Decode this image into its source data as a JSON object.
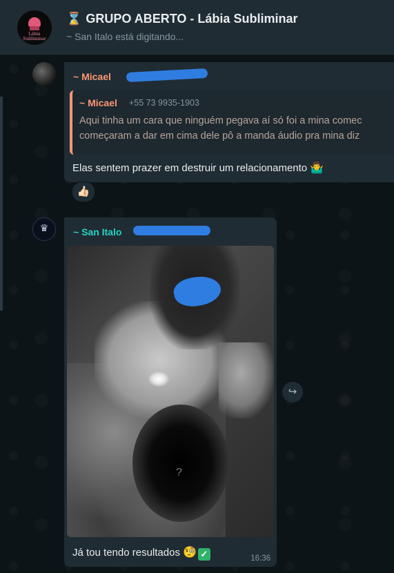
{
  "header": {
    "group_avatar_text": "Lábia Subliminar",
    "hourglass": "⌛",
    "title": "GRUPO ABERTO - Lábia Subliminar",
    "status": "~ San Italo está digitando..."
  },
  "messages": [
    {
      "sender": "~ Micael",
      "quote": {
        "name": "~ Micael",
        "phone": "+55 73 9935-1903",
        "lines": [
          "Aqui tinha um cara que ninguém pegava aí só foi a mina comec",
          "começaram a dar em cima dele pô a manda áudio pra mina diz"
        ]
      },
      "text": "Elas sentem prazer em destruir um relacionamento",
      "emoji": "🤷‍♂️",
      "reaction": "👍🏻"
    },
    {
      "sender": "~ San Italo",
      "photo_placeholder": "?",
      "text": "Já tou tendo resultados",
      "emoji": "🧐",
      "check": "✓",
      "time": "16:36"
    }
  ],
  "icons": {
    "forward": "↪",
    "crown": "♛"
  },
  "colors": {
    "header_bg": "#202c33",
    "bubble_bg": "#202c33",
    "micael_name": "#fc9775",
    "san_name": "#25d3c4",
    "redaction": "#2f7de0"
  }
}
